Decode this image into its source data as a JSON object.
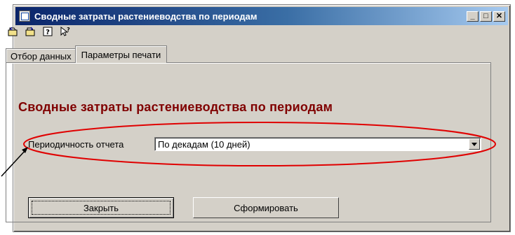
{
  "window": {
    "title": "Сводные затраты растениеводства по периодам",
    "buttons": {
      "minimize": "_",
      "maximize": "□",
      "close": "✕"
    }
  },
  "toolbar": {
    "icons": [
      "open-icon",
      "save-icon",
      "help-icon",
      "context-help-icon"
    ]
  },
  "tabs": [
    {
      "label": "Отбор данных",
      "active": false
    },
    {
      "label": "Параметры печати",
      "active": true
    }
  ],
  "panel": {
    "heading": "Сводные затраты растениеводства по периодам",
    "periodicity": {
      "label": "Периодичность отчета",
      "value": "По декадам (10 дней)"
    }
  },
  "actions": {
    "close_label": "Закрыть",
    "generate_label": "Сформировать"
  },
  "colors": {
    "heading": "#800000",
    "annotation": "#e00000",
    "window_bg": "#d4d0c8"
  }
}
